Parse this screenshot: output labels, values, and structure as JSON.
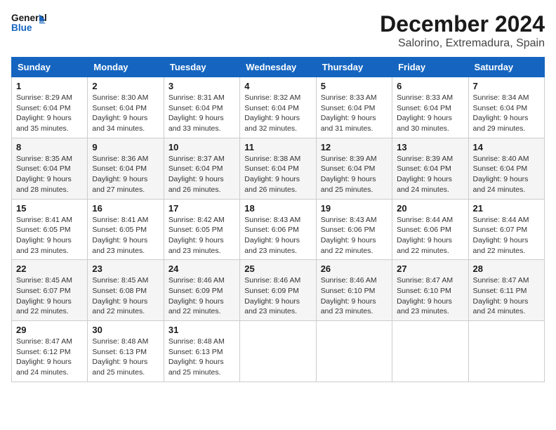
{
  "header": {
    "logo_line1": "General",
    "logo_line2": "Blue",
    "month": "December 2024",
    "location": "Salorino, Extremadura, Spain"
  },
  "weekdays": [
    "Sunday",
    "Monday",
    "Tuesday",
    "Wednesday",
    "Thursday",
    "Friday",
    "Saturday"
  ],
  "weeks": [
    [
      {
        "day": "1",
        "sunrise": "8:29 AM",
        "sunset": "6:04 PM",
        "daylight": "9 hours and 35 minutes."
      },
      {
        "day": "2",
        "sunrise": "8:30 AM",
        "sunset": "6:04 PM",
        "daylight": "9 hours and 34 minutes."
      },
      {
        "day": "3",
        "sunrise": "8:31 AM",
        "sunset": "6:04 PM",
        "daylight": "9 hours and 33 minutes."
      },
      {
        "day": "4",
        "sunrise": "8:32 AM",
        "sunset": "6:04 PM",
        "daylight": "9 hours and 32 minutes."
      },
      {
        "day": "5",
        "sunrise": "8:33 AM",
        "sunset": "6:04 PM",
        "daylight": "9 hours and 31 minutes."
      },
      {
        "day": "6",
        "sunrise": "8:33 AM",
        "sunset": "6:04 PM",
        "daylight": "9 hours and 30 minutes."
      },
      {
        "day": "7",
        "sunrise": "8:34 AM",
        "sunset": "6:04 PM",
        "daylight": "9 hours and 29 minutes."
      }
    ],
    [
      {
        "day": "8",
        "sunrise": "8:35 AM",
        "sunset": "6:04 PM",
        "daylight": "9 hours and 28 minutes."
      },
      {
        "day": "9",
        "sunrise": "8:36 AM",
        "sunset": "6:04 PM",
        "daylight": "9 hours and 27 minutes."
      },
      {
        "day": "10",
        "sunrise": "8:37 AM",
        "sunset": "6:04 PM",
        "daylight": "9 hours and 26 minutes."
      },
      {
        "day": "11",
        "sunrise": "8:38 AM",
        "sunset": "6:04 PM",
        "daylight": "9 hours and 26 minutes."
      },
      {
        "day": "12",
        "sunrise": "8:39 AM",
        "sunset": "6:04 PM",
        "daylight": "9 hours and 25 minutes."
      },
      {
        "day": "13",
        "sunrise": "8:39 AM",
        "sunset": "6:04 PM",
        "daylight": "9 hours and 24 minutes."
      },
      {
        "day": "14",
        "sunrise": "8:40 AM",
        "sunset": "6:04 PM",
        "daylight": "9 hours and 24 minutes."
      }
    ],
    [
      {
        "day": "15",
        "sunrise": "8:41 AM",
        "sunset": "6:05 PM",
        "daylight": "9 hours and 23 minutes."
      },
      {
        "day": "16",
        "sunrise": "8:41 AM",
        "sunset": "6:05 PM",
        "daylight": "9 hours and 23 minutes."
      },
      {
        "day": "17",
        "sunrise": "8:42 AM",
        "sunset": "6:05 PM",
        "daylight": "9 hours and 23 minutes."
      },
      {
        "day": "18",
        "sunrise": "8:43 AM",
        "sunset": "6:06 PM",
        "daylight": "9 hours and 23 minutes."
      },
      {
        "day": "19",
        "sunrise": "8:43 AM",
        "sunset": "6:06 PM",
        "daylight": "9 hours and 22 minutes."
      },
      {
        "day": "20",
        "sunrise": "8:44 AM",
        "sunset": "6:06 PM",
        "daylight": "9 hours and 22 minutes."
      },
      {
        "day": "21",
        "sunrise": "8:44 AM",
        "sunset": "6:07 PM",
        "daylight": "9 hours and 22 minutes."
      }
    ],
    [
      {
        "day": "22",
        "sunrise": "8:45 AM",
        "sunset": "6:07 PM",
        "daylight": "9 hours and 22 minutes."
      },
      {
        "day": "23",
        "sunrise": "8:45 AM",
        "sunset": "6:08 PM",
        "daylight": "9 hours and 22 minutes."
      },
      {
        "day": "24",
        "sunrise": "8:46 AM",
        "sunset": "6:09 PM",
        "daylight": "9 hours and 22 minutes."
      },
      {
        "day": "25",
        "sunrise": "8:46 AM",
        "sunset": "6:09 PM",
        "daylight": "9 hours and 23 minutes."
      },
      {
        "day": "26",
        "sunrise": "8:46 AM",
        "sunset": "6:10 PM",
        "daylight": "9 hours and 23 minutes."
      },
      {
        "day": "27",
        "sunrise": "8:47 AM",
        "sunset": "6:10 PM",
        "daylight": "9 hours and 23 minutes."
      },
      {
        "day": "28",
        "sunrise": "8:47 AM",
        "sunset": "6:11 PM",
        "daylight": "9 hours and 24 minutes."
      }
    ],
    [
      {
        "day": "29",
        "sunrise": "8:47 AM",
        "sunset": "6:12 PM",
        "daylight": "9 hours and 24 minutes."
      },
      {
        "day": "30",
        "sunrise": "8:48 AM",
        "sunset": "6:13 PM",
        "daylight": "9 hours and 25 minutes."
      },
      {
        "day": "31",
        "sunrise": "8:48 AM",
        "sunset": "6:13 PM",
        "daylight": "9 hours and 25 minutes."
      },
      null,
      null,
      null,
      null
    ]
  ]
}
